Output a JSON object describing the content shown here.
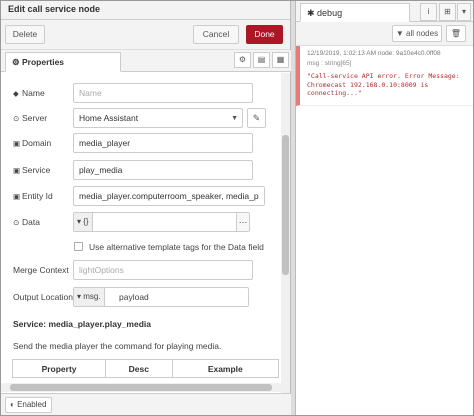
{
  "editor": {
    "title": "Edit call service node",
    "delete_label": "Delete",
    "cancel_label": "Cancel",
    "done_label": "Done",
    "properties_tab": "Properties",
    "enabled_label": "Enabled"
  },
  "form": {
    "name": {
      "label": "Name",
      "placeholder": "Name",
      "value": ""
    },
    "server": {
      "label": "Server",
      "value": "Home Assistant"
    },
    "domain": {
      "label": "Domain",
      "value": "media_player"
    },
    "service": {
      "label": "Service",
      "value": "play_media"
    },
    "entity_id": {
      "label": "Entity Id",
      "value": "media_player.computerroom_speaker, media_p"
    },
    "data": {
      "label": "Data",
      "type_label": "{}",
      "value": ""
    },
    "alt_tags": {
      "label": "Use alternative template tags for the Data field",
      "checked": false
    },
    "merge_context": {
      "label": "Merge Context",
      "placeholder": "lightOptions",
      "value": ""
    },
    "output_location": {
      "label": "Output Location",
      "type_label": "msg.",
      "value": "payload"
    }
  },
  "help": {
    "title": "Service: media_player.play_media",
    "text": "Send the media player the command for playing media.",
    "table_headers": [
      "Property",
      "Desc",
      "Example"
    ]
  },
  "debug": {
    "tab_label": "debug",
    "filter_label": "all nodes",
    "messages": [
      {
        "meta": "12/19/2019, 1:02:13 AM   node: 9a10e4c0.0ff08",
        "type": "msg : string[65]",
        "body": "\"Call-service API error. Error Message: Chromecast 192.168.0.10:8009 is connecting...\"",
        "level": "error"
      }
    ]
  },
  "colors": {
    "done_button": "#ad1625",
    "error_marker": "#e07c79",
    "error_text": "#b02d2d"
  },
  "icons": {
    "properties": "cog-icon",
    "name": "tag-icon",
    "server": "server-icon",
    "domain": "cube-icon",
    "service": "cube-icon",
    "entity_id": "cube-icon",
    "data": "circle-dot-icon",
    "debug": "bug-icon",
    "filter": "filter-icon",
    "trash": "trash-icon",
    "info": "info-icon",
    "enabled": "toggle-icon"
  }
}
